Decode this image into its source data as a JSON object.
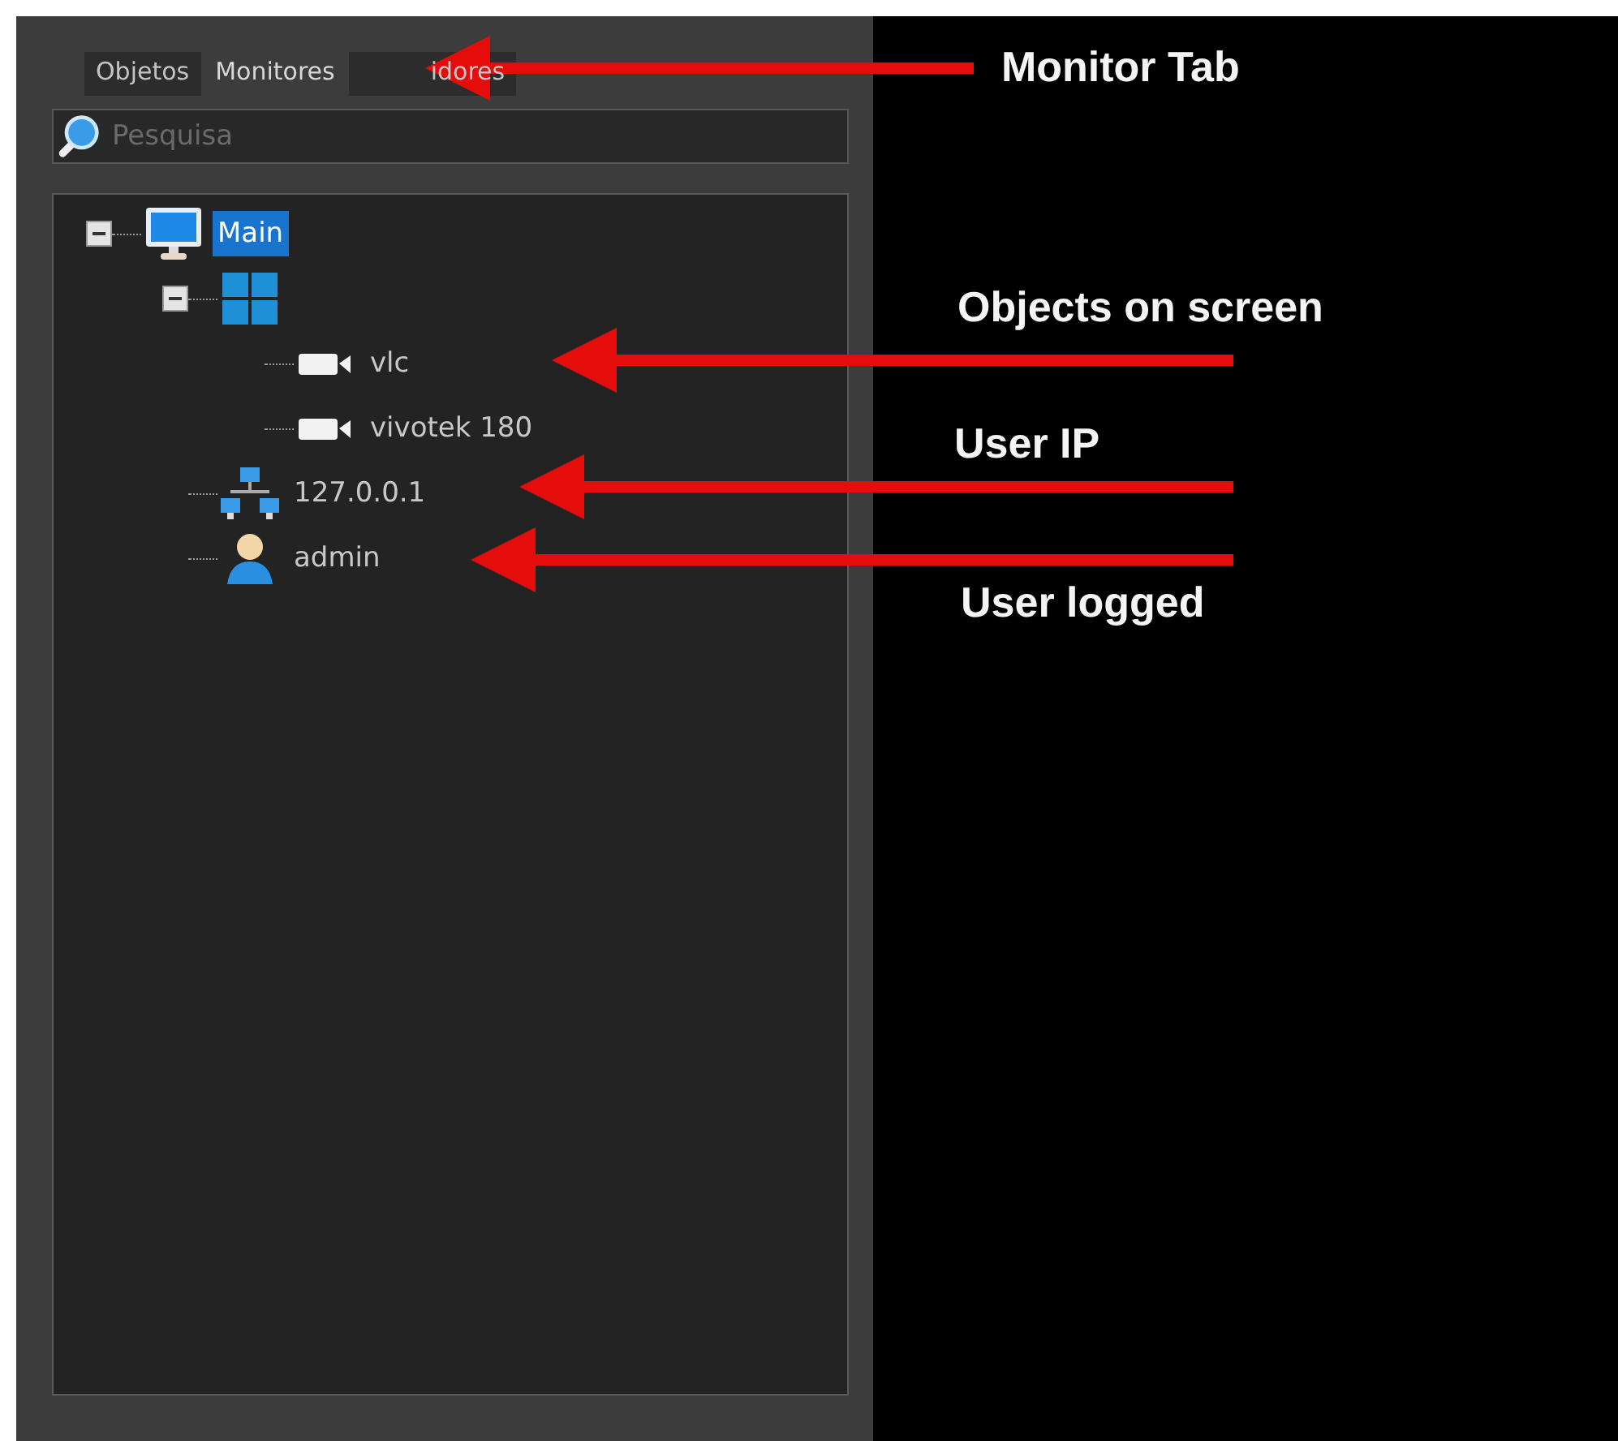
{
  "tabs": [
    {
      "label": "Objetos",
      "selected": false
    },
    {
      "label": "Monitores",
      "selected": true
    },
    {
      "label": "idores",
      "selected": false
    }
  ],
  "search": {
    "placeholder": "Pesquisa"
  },
  "tree": [
    {
      "kind": "monitor",
      "label": "Main",
      "selected": true,
      "expanded": true,
      "children": [
        {
          "kind": "layout",
          "selected": false,
          "expanded": true,
          "children": [
            {
              "kind": "camera",
              "label": "vlc",
              "selected": false
            },
            {
              "kind": "camera",
              "label": "vivotek 180",
              "selected": false
            }
          ]
        },
        {
          "kind": "network",
          "label": "127.0.0.1",
          "selected": false
        },
        {
          "kind": "user",
          "label": "admin",
          "selected": false
        }
      ]
    }
  ],
  "annotations": [
    {
      "text": "Monitor Tab"
    },
    {
      "text": "Objects on screen"
    },
    {
      "text": "User IP"
    },
    {
      "text": "User logged"
    }
  ]
}
